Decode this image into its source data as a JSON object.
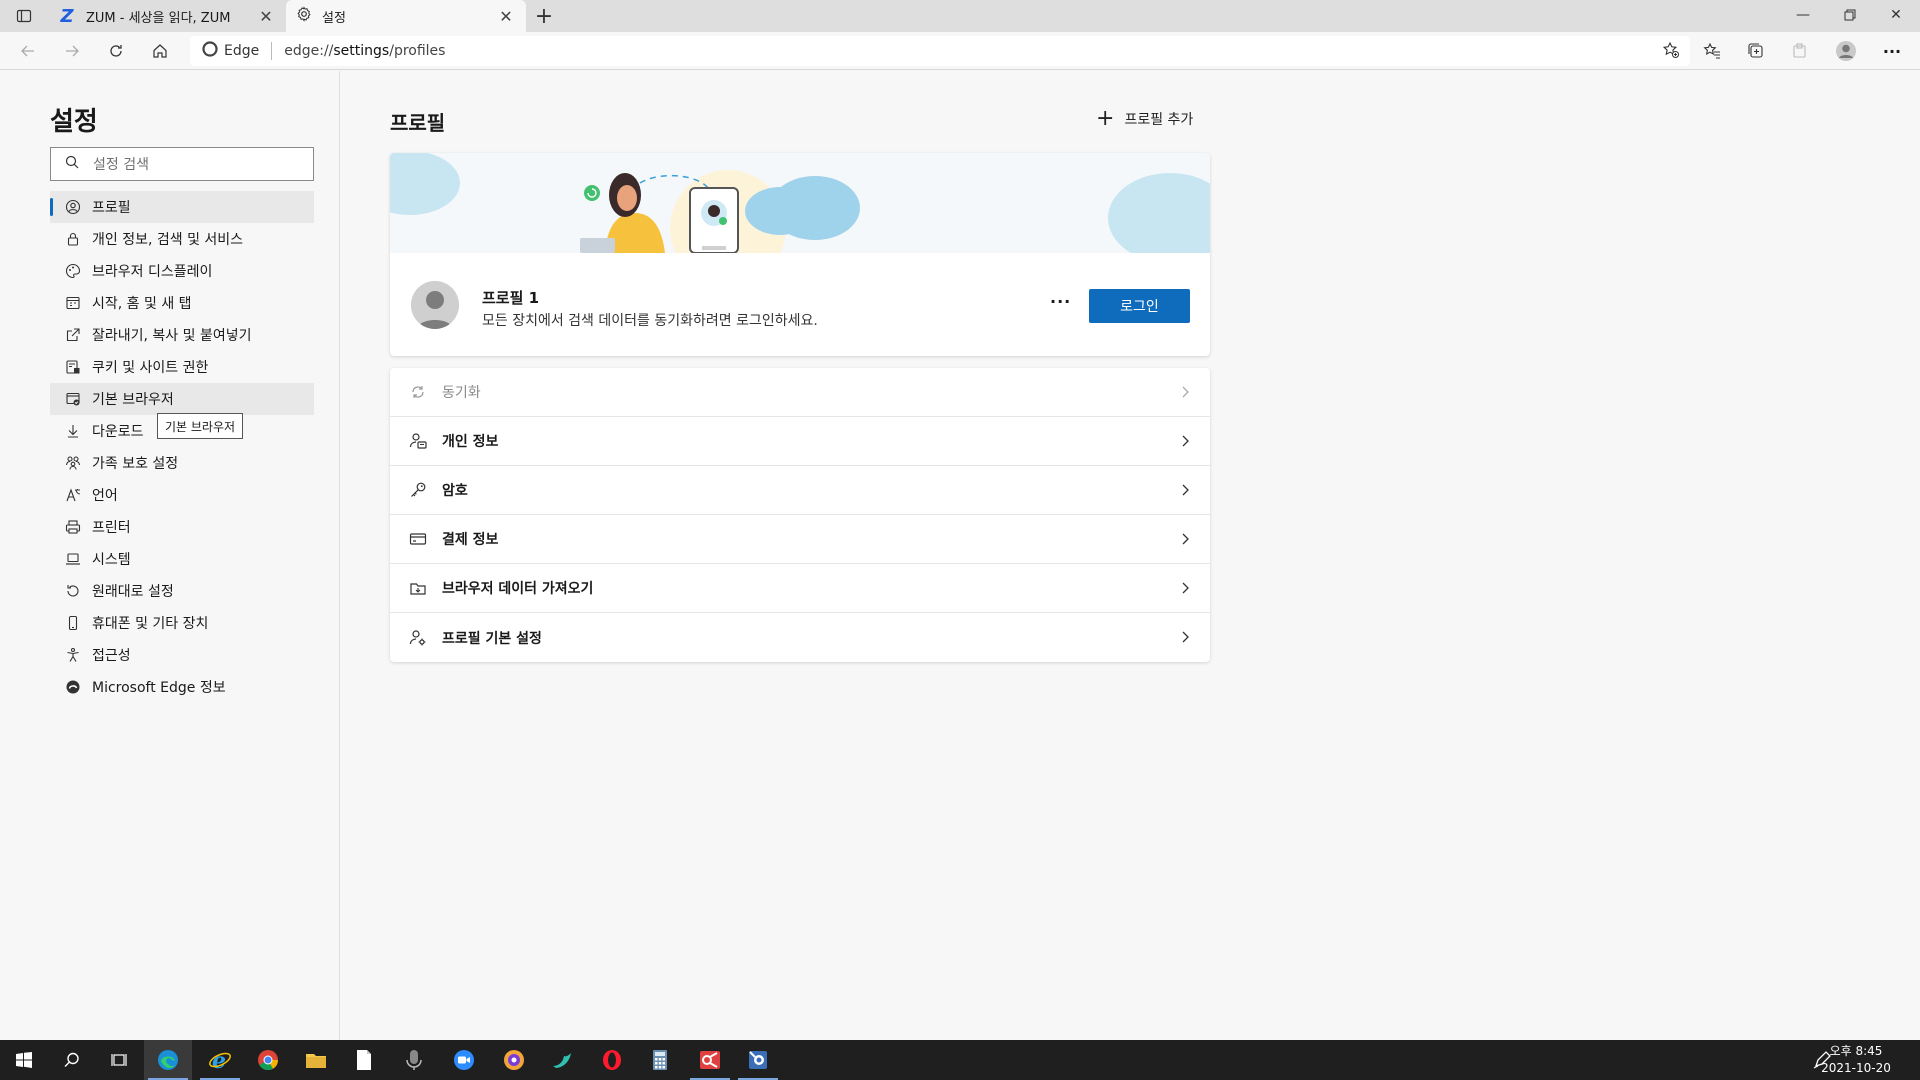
{
  "tabs": [
    {
      "title": "ZUM - 세상을 읽다, ZUM",
      "logo": "Z"
    },
    {
      "title": "설정"
    }
  ],
  "address": {
    "site_label": "Edge",
    "url_prefix": "edge://",
    "url_main": "settings",
    "url_suffix": "/profiles"
  },
  "sidebar": {
    "title": "설정",
    "search_placeholder": "설정 검색",
    "items": [
      {
        "label": "프로필",
        "icon": "profile-icon"
      },
      {
        "label": "개인 정보, 검색 및 서비스",
        "icon": "lock-icon"
      },
      {
        "label": "브라우저 디스플레이",
        "icon": "palette-icon"
      },
      {
        "label": "시작, 홈 및 새 탭",
        "icon": "home-grid-icon"
      },
      {
        "label": "잘라내기, 복사 및 붙여넣기",
        "icon": "share-icon"
      },
      {
        "label": "쿠키 및 사이트 권한",
        "icon": "site-permissions-icon"
      },
      {
        "label": "기본 브라우저",
        "icon": "default-browser-icon"
      },
      {
        "label": "다운로드",
        "icon": "download-icon"
      },
      {
        "label": "가족 보호 설정",
        "icon": "family-icon"
      },
      {
        "label": "언어",
        "icon": "language-icon"
      },
      {
        "label": "프린터",
        "icon": "printer-icon"
      },
      {
        "label": "시스템",
        "icon": "laptop-icon"
      },
      {
        "label": "원래대로 설정",
        "icon": "reset-icon"
      },
      {
        "label": "휴대폰 및 기타 장치",
        "icon": "phone-icon"
      },
      {
        "label": "접근성",
        "icon": "accessibility-icon"
      },
      {
        "label": "Microsoft Edge 정보",
        "icon": "edge-icon"
      }
    ],
    "tooltip": "기본 브라우저"
  },
  "main": {
    "title": "프로필",
    "add_profile": "프로필 추가",
    "profile": {
      "name": "프로필 1",
      "description": "모든 장치에서 검색 데이터를 동기화하려면 로그인하세요.",
      "more": "···",
      "login": "로그인"
    },
    "rows": [
      {
        "label": "동기화",
        "icon": "sync-icon",
        "disabled": true
      },
      {
        "label": "개인 정보",
        "icon": "personal-info-icon"
      },
      {
        "label": "암호",
        "icon": "key-icon"
      },
      {
        "label": "결제 정보",
        "icon": "card-icon"
      },
      {
        "label": "브라우저 데이터 가져오기",
        "icon": "import-icon"
      },
      {
        "label": "프로필 기본 설정",
        "icon": "profile-settings-icon"
      }
    ]
  },
  "taskbar": {
    "time": "오후 8:45",
    "date": "2021-10-20"
  },
  "colors": {
    "accent": "#0f6cbd",
    "taskbar": "#1f1f1f"
  }
}
